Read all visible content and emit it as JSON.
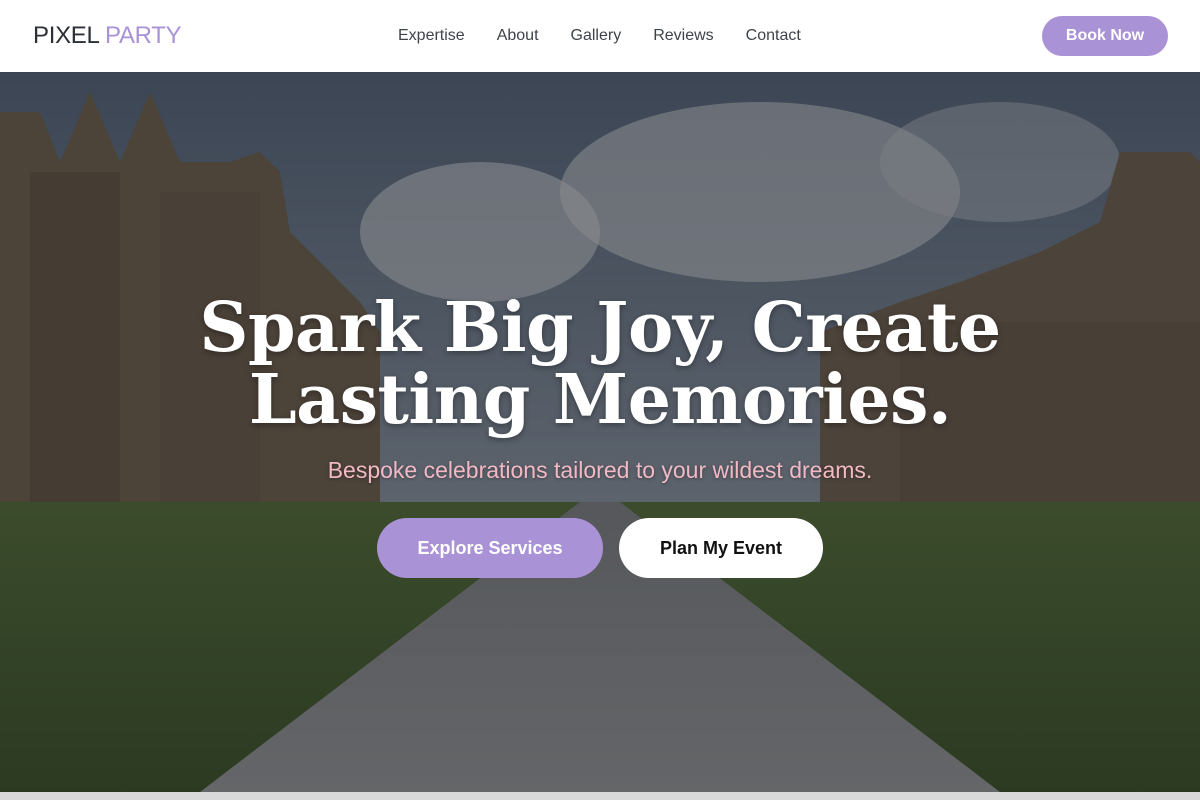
{
  "brand": {
    "word1": "PIXEL",
    "word2": "PARTY",
    "accent": "#a992d6"
  },
  "nav": {
    "items": [
      {
        "label": "Expertise"
      },
      {
        "label": "About"
      },
      {
        "label": "Gallery"
      },
      {
        "label": "Reviews"
      },
      {
        "label": "Contact"
      }
    ],
    "cta_label": "Book Now"
  },
  "hero": {
    "headline_line1": "Spark Big Joy, Create",
    "headline_line2": "Lasting Memories.",
    "subheadline": "Bespoke celebrations tailored to your wildest dreams.",
    "subheadline_color": "#f2b9c4",
    "primary_cta": "Explore Services",
    "secondary_cta": "Plan My Event"
  }
}
